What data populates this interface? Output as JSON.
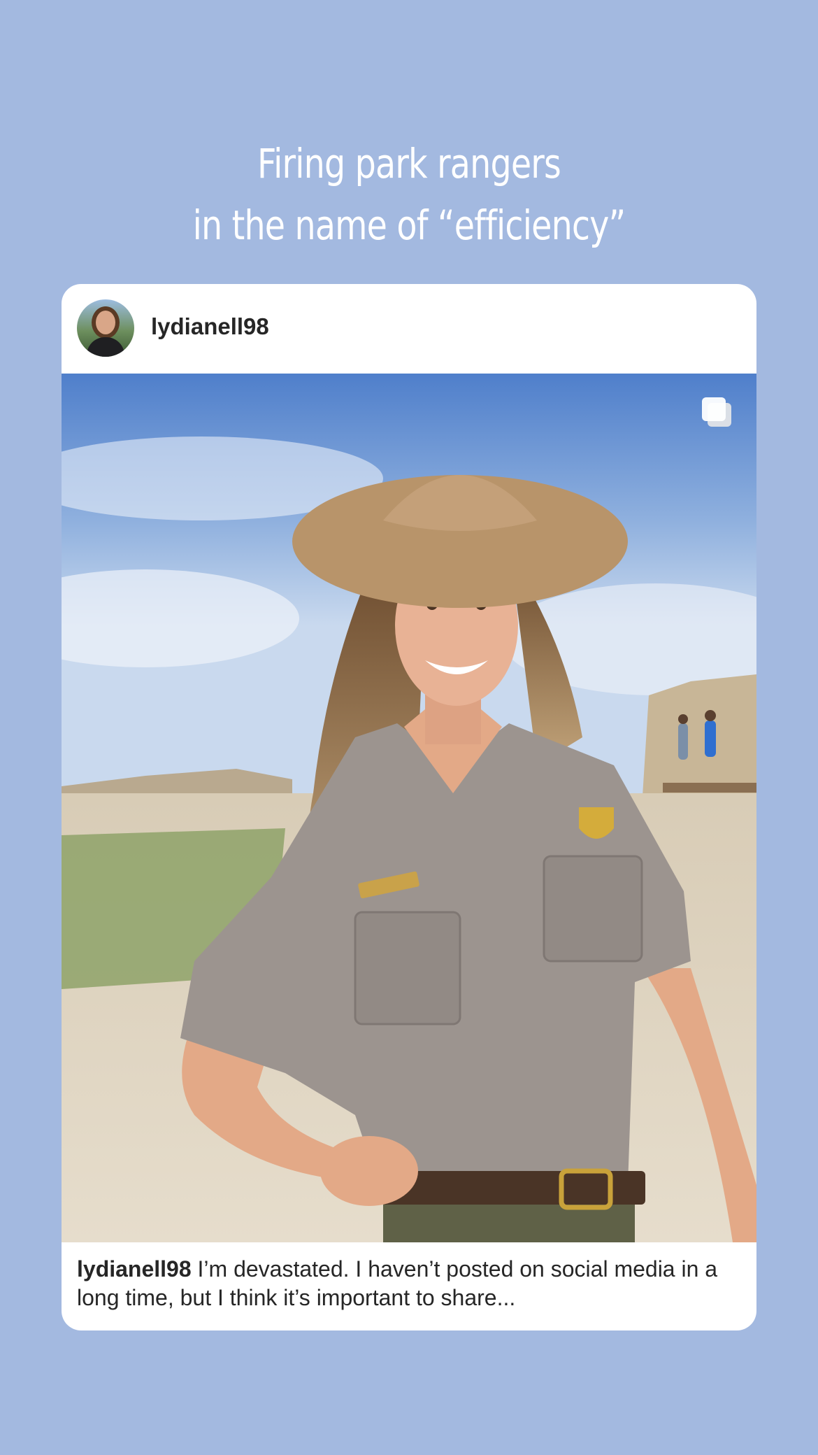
{
  "headline": {
    "line1": "Firing park rangers",
    "line2": "in the name of “efficiency”"
  },
  "post": {
    "username": "lydianell98",
    "avatar_icon": "profile-photo-avatar",
    "media_icon": "carousel-multiple-icon",
    "photo_description_icon": "ranger-photo",
    "caption_user": "lydianell98",
    "caption_text": "I’m devastated. I haven’t posted on social media in a long time, but I think it’s important to share..."
  },
  "colors": {
    "background": "#a3b9e0",
    "card": "#ffffff",
    "text": "#262626"
  }
}
